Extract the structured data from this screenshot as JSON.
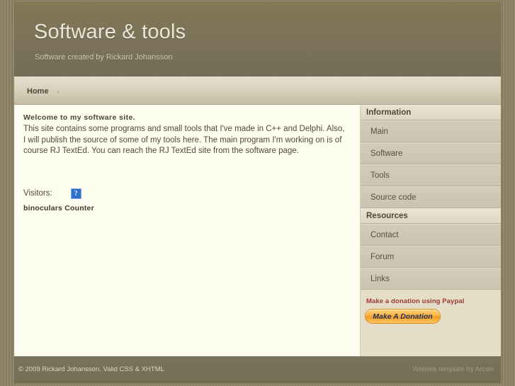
{
  "site": {
    "title": "Software & tools",
    "subtitle": "Software created by Rickard Johansson"
  },
  "nav": {
    "breadcrumb": [
      {
        "label": "Home"
      }
    ],
    "separator": "›"
  },
  "content": {
    "welcome_heading": "Welcome to my software site.",
    "intro_paragraph": "This site contains some programs and small tools that I've made in C++ and Delphi. Also, I will publish the source of some of my tools here. The main program I'm working on is of course RJ TextEd. You can reach the RJ TextEd site from the software page.",
    "visitors_label": "Visitors:",
    "counter_caption": "binoculars Counter",
    "counter_icon": "broken-image-icon"
  },
  "sidebar": {
    "sections": [
      {
        "title": "Information",
        "items": [
          {
            "label": "Main"
          },
          {
            "label": "Software"
          },
          {
            "label": "Tools"
          },
          {
            "label": "Source code"
          }
        ]
      },
      {
        "title": "Resources",
        "items": [
          {
            "label": "Contact"
          },
          {
            "label": "Forum"
          },
          {
            "label": "Links"
          }
        ]
      }
    ],
    "donation": {
      "text": "Make a donation using Paypal",
      "button_label": "Make A Donation"
    }
  },
  "footer": {
    "left": "© 2009 Rickard Johansson. Valid CSS & XHTML",
    "right": "Website template by Arcsin"
  },
  "colors": {
    "header_bg": "#7b7259",
    "content_bg": "#fdfdf0",
    "sidebar_bg": "#e4ddc8",
    "sidebar_item_bg": "#cec7b3",
    "nav_bg": "#d6cfba",
    "donation_text": "#9b3b32",
    "donate_button": "#f5a623",
    "frame": "#8d8468"
  }
}
